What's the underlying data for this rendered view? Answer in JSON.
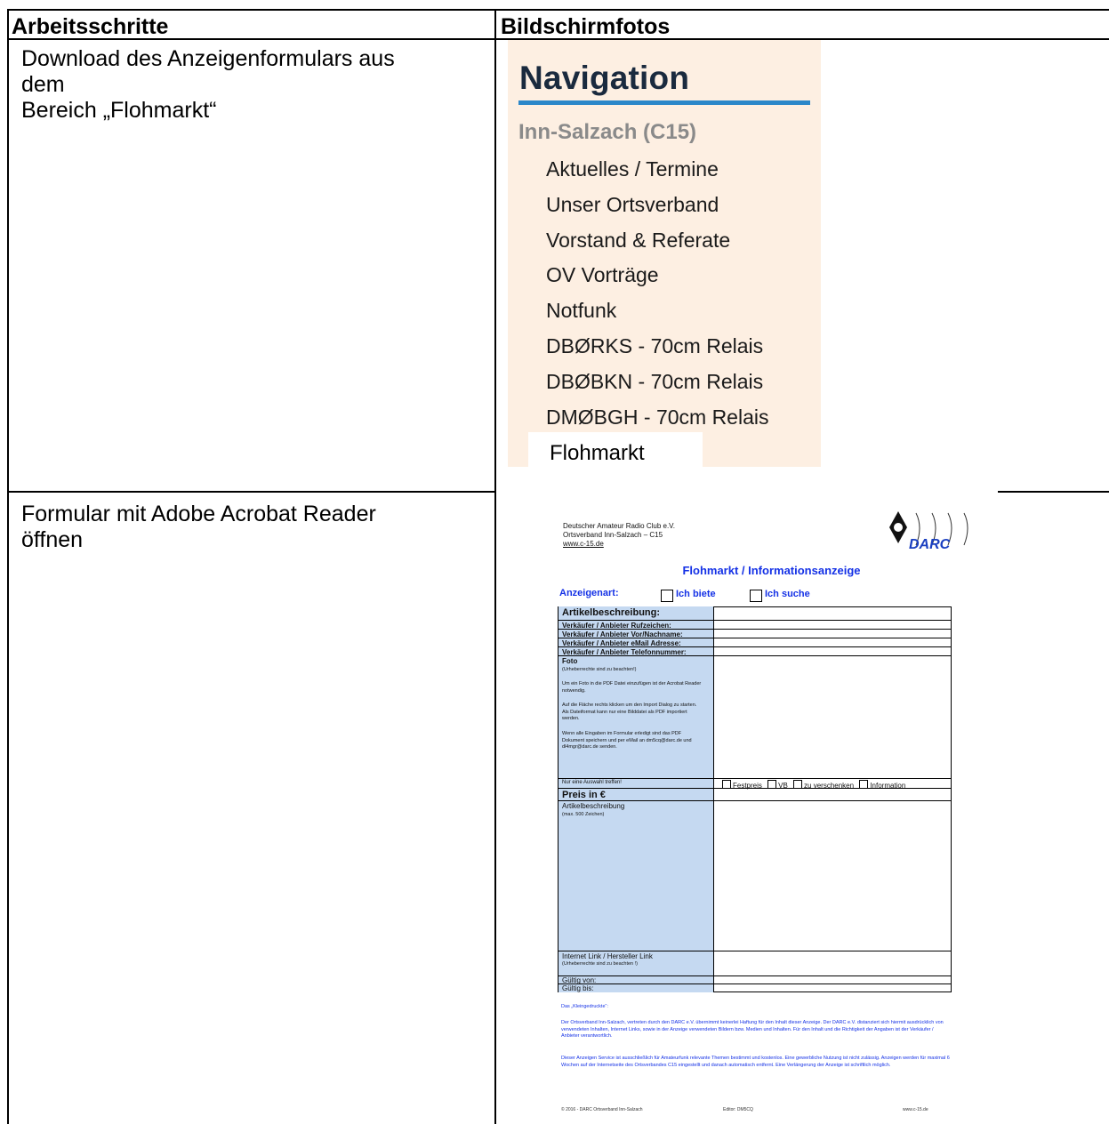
{
  "table": {
    "header_col1": "Arbeitsschritte",
    "header_col2": "Bildschirmfotos",
    "row1_step": [
      "Download des Anzeigenformulars aus",
      "dem",
      "Bereich „Flohmarkt“"
    ],
    "row2_step": [
      "Formular mit Adobe Acrobat Reader",
      "öffnen"
    ]
  },
  "nav": {
    "title": "Navigation",
    "section": "Inn-Salzach (C15)",
    "items": [
      "Aktuelles / Termine",
      "Unser Ortsverband",
      "Vorstand & Referate",
      "OV Vorträge",
      "Notfunk",
      "DBØRKS - 70cm Relais",
      "DBØBKN - 70cm Relais",
      "DMØBGH - 70cm Relais"
    ],
    "highlight": "Flohmarkt"
  },
  "form": {
    "org_lines": [
      "Deutscher Amateur Radio Club e.V.",
      "Ortsverband Inn-Salzach – C15"
    ],
    "org_url": "www.c-15.de",
    "logo_text": "DARC",
    "title": "Flohmarkt / Informationsanzeige",
    "type_label": "Anzeigenart:",
    "type_option1": "Ich biete",
    "type_option2": "Ich suche",
    "rows": {
      "artikel": "Artikelbeschreibung:",
      "rufzeichen": "Verkäufer / Anbieter Rufzeichen:",
      "name": "Verkäufer / Anbieter Vor/Nachname:",
      "email": "Verkäufer / Anbieter eMail Adresse:",
      "telefon": "Verkäufer / Anbieter Telefonnummer:",
      "foto": "Foto",
      "foto_note": "(Urheberrechte sind zu beachten!)",
      "foto_help1": "Um ein Foto in die PDF Datei einzufügen ist der Acrobat Reader notwendig.",
      "foto_help2": "Auf die Fläche rechts klicken um den Import Dialog zu starten. Als Dateiformat kann nur eine Bilddatei als PDF importiert werden.",
      "foto_help3": "Wenn alle Eingaben im Formular erledigt sind das PDF Dokument speichern und per eMail an dm5cq@darc.de und dl4mgr@darc.de senden.",
      "auswahl": "Nur eine Auswahl treffen!",
      "opt_festpreis": "Festpreis",
      "opt_vb": "VB",
      "opt_verschenken": "zu verschenken",
      "opt_information": "Information",
      "preis": "Preis in €",
      "beschreibung": "Artikelbeschreibung",
      "beschreibung_note": "(max. 500 Zeichen)",
      "link": "Internet Link / Hersteller Link",
      "link_note": "(Urheberrechte sind zu beachten !)",
      "gueltig_von": "Gültig von:",
      "gueltig_bis": "Gültig bis:"
    },
    "footer_head": "Das „Kleingedruckte“:",
    "footer_p1": "Der Ortsverband Inn-Salzach, vertreten durch den DARC e.V. übernimmt keinerlei Haftung für den Inhalt dieser Anzeige. Der DARC e.V. distanziert sich hiermit ausdrücklich von verwendeten Inhalten, Internet Links, sowie in der Anzeige verwendeten Bildern bzw. Medien und Inhalten. Für den Inhalt und die Richtigkeit der Angaben ist der Verkäufer / Anbieter verantwortlich.",
    "footer_p2": "Dieser Anzeigen Service ist ausschließlich für Amateurfunk relevante Themen bestimmt und kostenlos. Eine gewerbliche Nutzung ist nicht zulässig. Anzeigen werden für maximal 6 Wochen auf der Internetseite des Ortsverbandes C15 eingestellt und danach automatisch entfernt. Eine Verlängerung der Anzeige ist schriftlich möglich.",
    "bottom_left": "© 2016 - DARC Ortsverband Inn-Salzach",
    "bottom_mid": "Editor: DM5CQ",
    "bottom_right": "www.c-15.de"
  }
}
